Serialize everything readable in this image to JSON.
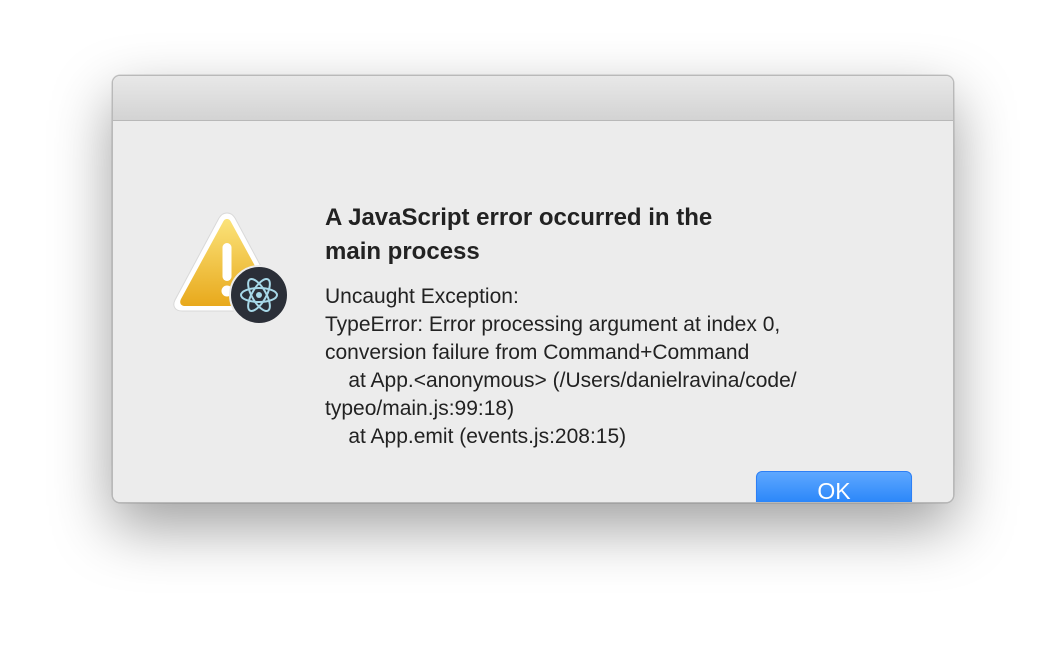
{
  "dialog": {
    "heading": "A JavaScript error occurred in the\nmain process",
    "message": "Uncaught Exception:\nTypeError: Error processing argument at index 0,\nconversion failure from Command+Command\n    at App.<anonymous> (/Users/danielravina/code/\ntypeo/main.js:99:18)\n    at App.emit (events.js:208:15)",
    "ok_label": "OK",
    "icon": "warning-icon",
    "badge_icon": "electron-icon"
  },
  "colors": {
    "button_accent": "#1e7ef8",
    "warning_yellow": "#f1c232",
    "badge_background": "#2b2f38",
    "window_background": "#ececec"
  }
}
